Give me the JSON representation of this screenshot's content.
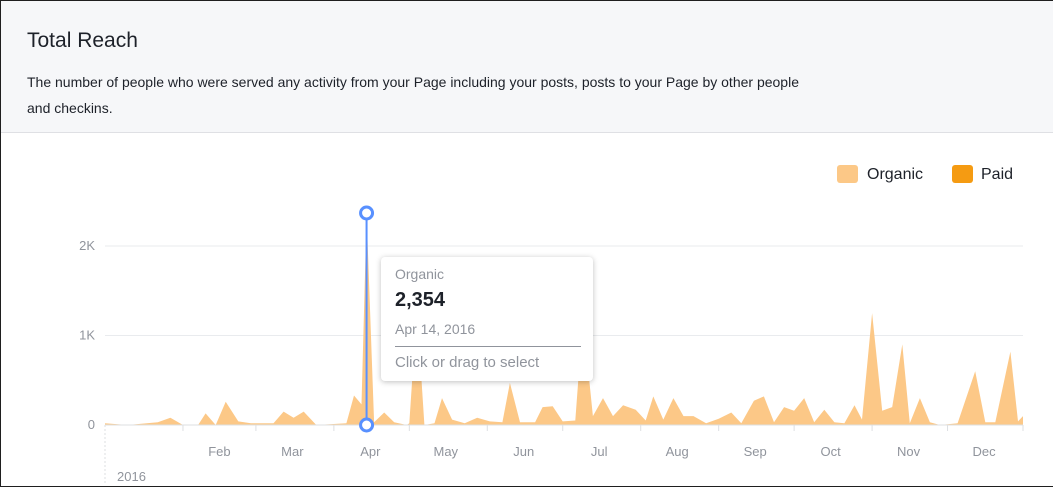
{
  "header": {
    "title": "Total Reach",
    "description_line1": "The number of people who were served any activity from your Page including your posts, posts to your Page by other people",
    "description_line2": "and checkins."
  },
  "tooltip": {
    "series": "Organic",
    "value": "2,354",
    "date": "Apr 14, 2016",
    "hint": "Click or drag to select"
  },
  "colors": {
    "organic": "#fcc887",
    "paid": "#f59b12",
    "cursor": "#5890ff",
    "grid": "#e9ebee"
  },
  "chart_data": {
    "type": "area",
    "title": "Total Reach",
    "xlabel": "",
    "ylabel": "",
    "year_label": "2016",
    "x_domain": [
      "2016-01-01",
      "2016-12-31"
    ],
    "ylim": [
      0,
      2600
    ],
    "y_ticks": [
      {
        "value": 0,
        "label": "0"
      },
      {
        "value": 1000,
        "label": "1K"
      },
      {
        "value": 2000,
        "label": "2K"
      }
    ],
    "x_ticks": [
      {
        "date": "2016-02-01",
        "label": "Feb"
      },
      {
        "date": "2016-03-01",
        "label": "Mar"
      },
      {
        "date": "2016-04-01",
        "label": "Apr"
      },
      {
        "date": "2016-05-01",
        "label": "May"
      },
      {
        "date": "2016-06-01",
        "label": "Jun"
      },
      {
        "date": "2016-07-01",
        "label": "Jul"
      },
      {
        "date": "2016-08-01",
        "label": "Aug"
      },
      {
        "date": "2016-09-01",
        "label": "Sep"
      },
      {
        "date": "2016-10-01",
        "label": "Oct"
      },
      {
        "date": "2016-11-01",
        "label": "Nov"
      },
      {
        "date": "2016-12-01",
        "label": "Dec"
      }
    ],
    "legend": {
      "position": "top-right",
      "entries": [
        "Organic",
        "Paid"
      ]
    },
    "grid": true,
    "highlight": {
      "date": "2016-04-14",
      "value": 2354
    },
    "series": [
      {
        "name": "Organic",
        "points": [
          [
            "2016-01-01",
            20
          ],
          [
            "2016-01-10",
            0
          ],
          [
            "2016-01-22",
            30
          ],
          [
            "2016-01-27",
            80
          ],
          [
            "2016-02-01",
            0
          ],
          [
            "2016-02-07",
            0
          ],
          [
            "2016-02-10",
            130
          ],
          [
            "2016-02-14",
            0
          ],
          [
            "2016-02-18",
            260
          ],
          [
            "2016-02-23",
            40
          ],
          [
            "2016-02-28",
            20
          ],
          [
            "2016-03-08",
            20
          ],
          [
            "2016-03-12",
            150
          ],
          [
            "2016-03-16",
            80
          ],
          [
            "2016-03-20",
            150
          ],
          [
            "2016-03-25",
            0
          ],
          [
            "2016-04-06",
            20
          ],
          [
            "2016-04-09",
            330
          ],
          [
            "2016-04-12",
            230
          ],
          [
            "2016-04-14",
            2354
          ],
          [
            "2016-04-17",
            30
          ],
          [
            "2016-04-21",
            140
          ],
          [
            "2016-04-25",
            30
          ],
          [
            "2016-04-30",
            0
          ],
          [
            "2016-05-01",
            20
          ],
          [
            "2016-05-04",
            1300
          ],
          [
            "2016-05-07",
            0
          ],
          [
            "2016-05-11",
            20
          ],
          [
            "2016-05-14",
            300
          ],
          [
            "2016-05-18",
            60
          ],
          [
            "2016-05-23",
            20
          ],
          [
            "2016-05-28",
            80
          ],
          [
            "2016-06-02",
            40
          ],
          [
            "2016-06-07",
            30
          ],
          [
            "2016-06-10",
            470
          ],
          [
            "2016-06-14",
            30
          ],
          [
            "2016-06-20",
            30
          ],
          [
            "2016-06-23",
            200
          ],
          [
            "2016-06-27",
            210
          ],
          [
            "2016-07-01",
            40
          ],
          [
            "2016-07-06",
            50
          ],
          [
            "2016-07-09",
            1200
          ],
          [
            "2016-07-13",
            100
          ],
          [
            "2016-07-17",
            300
          ],
          [
            "2016-07-21",
            100
          ],
          [
            "2016-07-25",
            220
          ],
          [
            "2016-07-30",
            170
          ],
          [
            "2016-08-03",
            50
          ],
          [
            "2016-08-06",
            320
          ],
          [
            "2016-08-10",
            60
          ],
          [
            "2016-08-14",
            300
          ],
          [
            "2016-08-18",
            100
          ],
          [
            "2016-08-22",
            100
          ],
          [
            "2016-08-27",
            20
          ],
          [
            "2016-09-01",
            70
          ],
          [
            "2016-09-06",
            140
          ],
          [
            "2016-09-10",
            20
          ],
          [
            "2016-09-15",
            270
          ],
          [
            "2016-09-19",
            320
          ],
          [
            "2016-09-23",
            30
          ],
          [
            "2016-09-27",
            200
          ],
          [
            "2016-10-01",
            160
          ],
          [
            "2016-10-05",
            300
          ],
          [
            "2016-10-09",
            30
          ],
          [
            "2016-10-13",
            170
          ],
          [
            "2016-10-17",
            30
          ],
          [
            "2016-10-21",
            20
          ],
          [
            "2016-10-25",
            220
          ],
          [
            "2016-10-28",
            60
          ],
          [
            "2016-11-01",
            1250
          ],
          [
            "2016-11-05",
            160
          ],
          [
            "2016-11-09",
            200
          ],
          [
            "2016-11-13",
            900
          ],
          [
            "2016-11-16",
            20
          ],
          [
            "2016-11-20",
            300
          ],
          [
            "2016-11-24",
            30
          ],
          [
            "2016-11-28",
            0
          ],
          [
            "2016-12-05",
            20
          ],
          [
            "2016-12-12",
            600
          ],
          [
            "2016-12-16",
            30
          ],
          [
            "2016-12-20",
            30
          ],
          [
            "2016-12-26",
            820
          ],
          [
            "2016-12-29",
            40
          ],
          [
            "2016-12-31",
            100
          ]
        ]
      },
      {
        "name": "Paid",
        "points": [
          [
            "2016-01-01",
            0
          ],
          [
            "2016-12-31",
            0
          ]
        ]
      }
    ]
  }
}
